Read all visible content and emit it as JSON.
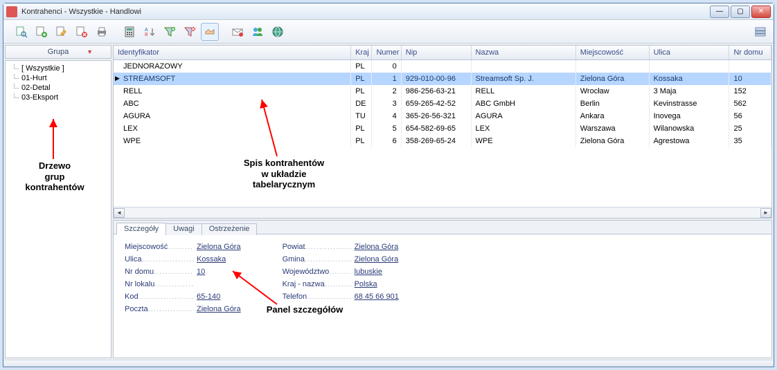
{
  "window": {
    "title": "Kontrahenci - Wszystkie - Handlowi"
  },
  "sidebar": {
    "header": "Grupa",
    "items": [
      {
        "label": "[ Wszystkie ]"
      },
      {
        "label": "01-Hurt"
      },
      {
        "label": "02-Detal"
      },
      {
        "label": "03-Eksport"
      }
    ]
  },
  "grid": {
    "columns": [
      "Identyfikator",
      "Kraj",
      "Numer",
      "Nip",
      "Nazwa",
      "Miejscowość",
      "Ulica",
      "Nr domu"
    ],
    "rows": [
      {
        "id": "JEDNORAZOWY",
        "kraj": "PL",
        "nr": "0",
        "nip": "",
        "nazwa": "",
        "miejsc": "",
        "ulica": "",
        "dom": ""
      },
      {
        "id": "STREAMSOFT",
        "kraj": "PL",
        "nr": "1",
        "nip": "929-010-00-96",
        "nazwa": "Streamsoft Sp. J.",
        "miejsc": "Zielona Góra",
        "ulica": "Kossaka",
        "dom": "10",
        "selected": true
      },
      {
        "id": "RELL",
        "kraj": "PL",
        "nr": "2",
        "nip": "986-256-63-21",
        "nazwa": "RELL",
        "miejsc": "Wrocław",
        "ulica": "3 Maja",
        "dom": "152"
      },
      {
        "id": "ABC",
        "kraj": "DE",
        "nr": "3",
        "nip": "659-265-42-52",
        "nazwa": "ABC GmbH",
        "miejsc": "Berlin",
        "ulica": "Kevinstrasse",
        "dom": "562"
      },
      {
        "id": "AGURA",
        "kraj": "TU",
        "nr": "4",
        "nip": "365-26-56-321",
        "nazwa": "AGURA",
        "miejsc": "Ankara",
        "ulica": "Inovega",
        "dom": "56"
      },
      {
        "id": "LEX",
        "kraj": "PL",
        "nr": "5",
        "nip": "654-582-69-65",
        "nazwa": "LEX",
        "miejsc": "Warszawa",
        "ulica": "Wilanowska",
        "dom": "25"
      },
      {
        "id": "WPE",
        "kraj": "PL",
        "nr": "6",
        "nip": "358-269-65-24",
        "nazwa": "WPE",
        "miejsc": "Zielona Góra",
        "ulica": "Agrestowa",
        "dom": "35"
      }
    ]
  },
  "detail": {
    "tabs": [
      "Szczegóły",
      "Uwagi",
      "Ostrzeżenie"
    ],
    "left": [
      {
        "label": "Miejscowość",
        "value": "Zielona Góra"
      },
      {
        "label": "Ulica",
        "value": "Kossaka"
      },
      {
        "label": "Nr domu",
        "value": "10"
      },
      {
        "label": "Nr lokalu",
        "value": ""
      },
      {
        "label": "Kod",
        "value": "65-140"
      },
      {
        "label": "Poczta",
        "value": "Zielona Góra"
      }
    ],
    "right": [
      {
        "label": "Powiat",
        "value": "Zielona Góra"
      },
      {
        "label": "Gmina",
        "value": "Zielona Góra"
      },
      {
        "label": "Województwo",
        "value": "lubuskie"
      },
      {
        "label": "Kraj - nazwa",
        "value": "Polska"
      },
      {
        "label": "Telefon",
        "value": "68 45 66 901"
      }
    ]
  },
  "annotations": {
    "tree": "Drzewo\ngrup\nkontrahentów",
    "grid": "Spis kontrahentów\nw układzie\ntabelarycznym",
    "panel": "Panel szczegółów"
  }
}
